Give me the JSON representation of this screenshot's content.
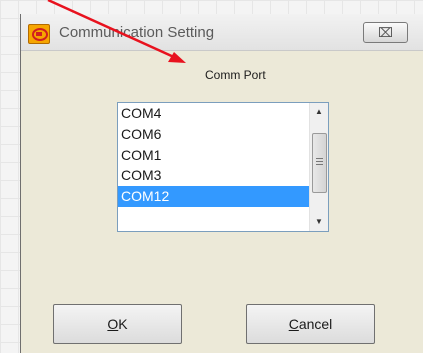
{
  "window": {
    "title": "Communication Setting",
    "close_label": "⌧"
  },
  "comm_port": {
    "label": "Comm Port",
    "items": [
      "COM4",
      "COM6",
      "COM1",
      "COM3",
      "COM12"
    ],
    "selected": "COM12"
  },
  "buttons": {
    "ok": {
      "mnemonic": "O",
      "rest": "K"
    },
    "cancel": {
      "mnemonic": "C",
      "rest": "ancel"
    }
  },
  "colors": {
    "selection": "#3399ff",
    "annotation_arrow": "#e8121e"
  },
  "icons": {
    "app": "app-logo-icon",
    "close": "close-icon",
    "scroll_up": "scroll-up-arrow-icon",
    "scroll_down": "scroll-down-arrow-icon"
  }
}
